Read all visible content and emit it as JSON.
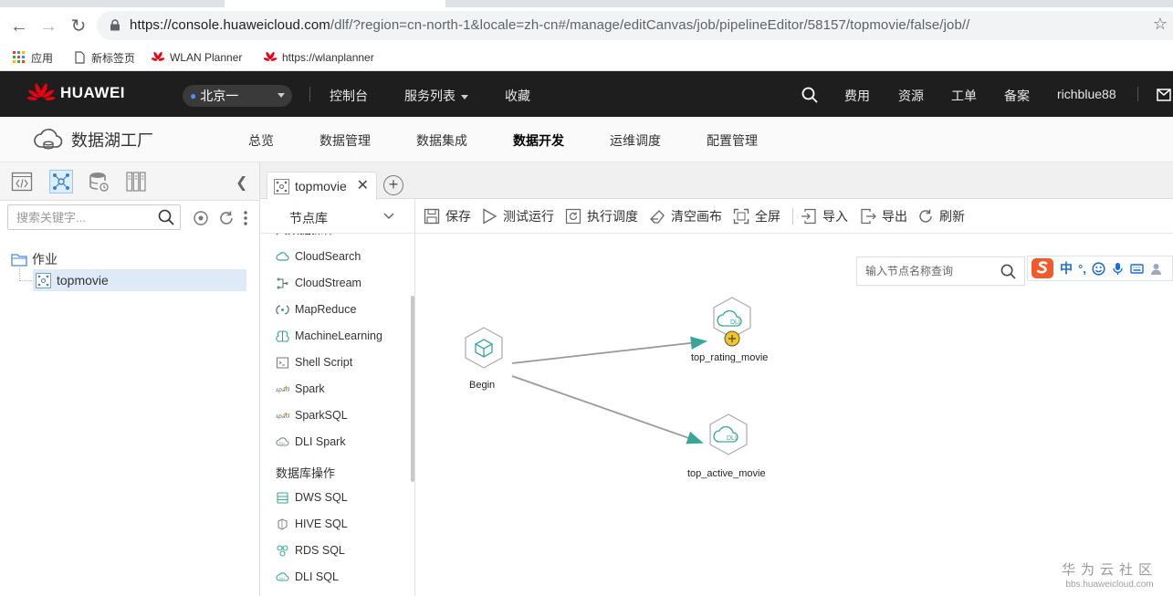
{
  "browser": {
    "url_host": "https://console.huaweicloud.com",
    "url_rest": "/dlf/?region=cn-north-1&locale=zh-cn#/manage/editCanvas/job/pipelineEditor/58157/topmovie/false/job//",
    "bookmarks": [
      "应用",
      "新标签页",
      "WLAN Planner",
      "https://wlanplanner"
    ]
  },
  "topbar": {
    "brand": "HUAWEI",
    "region": "北京一",
    "nav": [
      "控制台",
      "服务列表",
      "收藏"
    ],
    "right": [
      "费用",
      "资源",
      "工单",
      "备案",
      "richblue88"
    ]
  },
  "product": {
    "name": "数据湖工厂",
    "nav": [
      "总览",
      "数据管理",
      "数据集成",
      "数据开发",
      "运维调度",
      "配置管理"
    ],
    "active": "数据开发"
  },
  "left_panel": {
    "search_placeholder": "搜索关键字...",
    "tree_root": "作业",
    "tree_item": "topmovie"
  },
  "editor": {
    "tab_label": "topmovie",
    "node_library_title": "节点库",
    "nodes": [
      "CloudSearch",
      "CloudStream",
      "MapReduce",
      "MachineLearning",
      "Shell Script",
      "Spark",
      "SparkSQL",
      "DLI Spark"
    ],
    "db_category": "数据库操作",
    "db_nodes": [
      "DWS SQL",
      "HIVE SQL",
      "RDS SQL",
      "DLI SQL"
    ],
    "toolbar": [
      "保存",
      "测试运行",
      "执行调度",
      "清空画布",
      "全屏",
      "导入",
      "导出",
      "刷新"
    ],
    "canvas_search_placeholder": "输入节点名称查询",
    "ime_label": "中",
    "flow_nodes": {
      "begin": "Begin",
      "rating": "top_rating_movie",
      "active": "top_active_movie",
      "dli_badge": "DLI"
    }
  },
  "watermark": {
    "title": "华为云社区",
    "site": "bbs.huaweicloud.com"
  },
  "colors": {
    "topbar_bg": "#1e1e1e",
    "accent_teal": "#3aa69a",
    "warning_yellow": "#f5c518",
    "selected_row": "#dfeaf8"
  }
}
